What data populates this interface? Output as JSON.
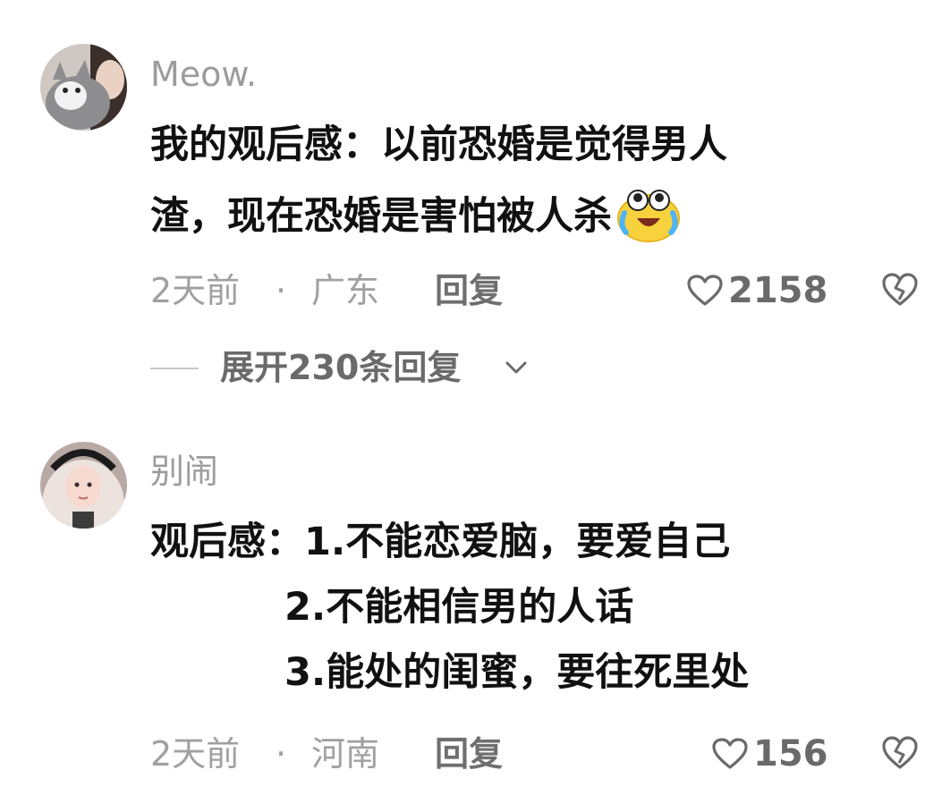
{
  "comments": [
    {
      "username": "Meow.",
      "content_lines": [
        "我的观后感：以前恐婚是觉得男人",
        "渣，现在恐婚是害怕被人杀"
      ],
      "emoji": "crying-laughing-emoji",
      "time": "2天前",
      "separator": "·",
      "location": "广东",
      "reply_label": "回复",
      "likes": "2158",
      "expand_label": "展开230条回复"
    },
    {
      "username": "别闹",
      "content_lines": [
        "观后感：1.不能恋爱脑，要爱自己",
        "2.不能相信男的人话",
        "3.能处的闺蜜，要往死里处"
      ],
      "time": "2天前",
      "separator": "·",
      "location": "河南",
      "reply_label": "回复",
      "likes": "156"
    }
  ],
  "icons": {
    "like": "heart-outline-icon",
    "dislike": "broken-heart-icon",
    "expand": "chevron-down-icon"
  },
  "colors": {
    "text": "#111111",
    "muted": "#a0a0a0",
    "action": "#6a6a6a"
  }
}
